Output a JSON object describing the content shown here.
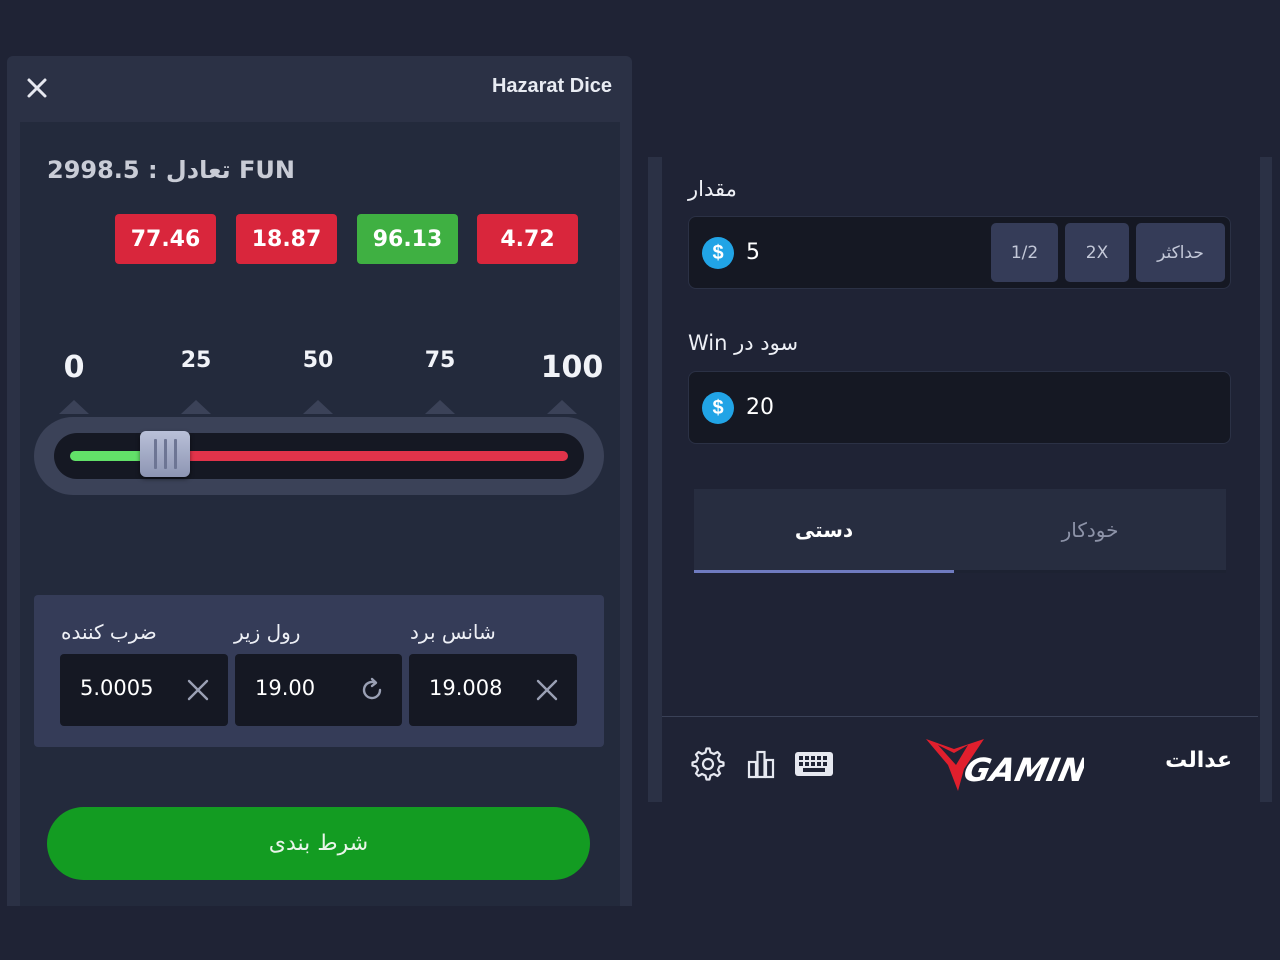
{
  "left": {
    "title": "Hazarat Dice",
    "balance_text": "2998.5 : تعادل FUN",
    "recent_results": [
      {
        "value": "77.46",
        "color": "#d9263c"
      },
      {
        "value": "18.87",
        "color": "#d9263c"
      },
      {
        "value": "96.13",
        "color": "#3fb042"
      },
      {
        "value": "4.72",
        "color": "#d9263c"
      }
    ],
    "slider": {
      "ticks": [
        "0",
        "25",
        "50",
        "75",
        "100"
      ],
      "value": 19,
      "green_color": "#62e069",
      "red_color": "#e2334a"
    },
    "stats": {
      "multiplier_label": "ضرب کننده",
      "multiplier_value": "5.0005",
      "roll_under_label": "رول زیر",
      "roll_under_value": "19.00",
      "win_chance_label": "شانس برد",
      "win_chance_value": "19.008"
    },
    "bet_button_label": "شرط بندی",
    "icons": {
      "close": "close-icon",
      "clear": "x-icon",
      "refresh": "refresh-icon"
    }
  },
  "right": {
    "amount_label": "مقدار",
    "amount_value": "5",
    "amount_buttons": {
      "half": "1/2",
      "double": "2X",
      "max": "حداکثر"
    },
    "profit_label": "سود در Win",
    "profit_value": "20",
    "currency_symbol": "$",
    "currency_color": "#21a4e6",
    "tabs": {
      "manual": "دستی",
      "auto": "خودکار"
    },
    "active_tab": "manual",
    "footer": {
      "icons": [
        "gear-icon",
        "bar-chart-icon",
        "keyboard-icon"
      ],
      "logo_text": "GAMING",
      "fairness_label": "عدالت"
    }
  },
  "colors": {
    "background": "#1f2335",
    "panel": "#2b3145",
    "bet_green": "#139c22",
    "accent_tab": "#6f7bc0"
  }
}
